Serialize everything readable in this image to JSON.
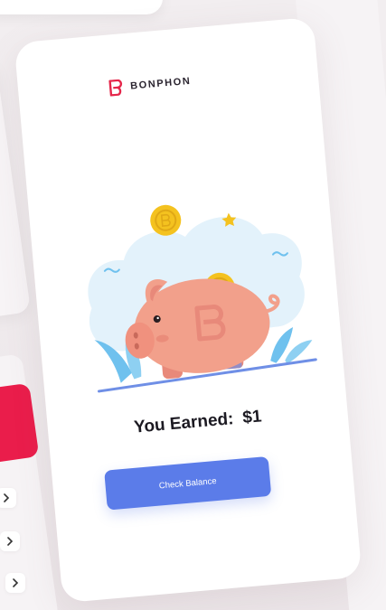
{
  "app": {
    "brand_name": "BONPHON",
    "logo_icon": "bonphon-logo-icon"
  },
  "main": {
    "earned_label": "You Earned:",
    "earned_amount": "$1",
    "check_balance_label": "Check Balance"
  },
  "illustration": {
    "icon": "piggy-bank-icon",
    "coin_icon": "coin-icon"
  },
  "colors": {
    "brand_red": "#e5264a",
    "button_blue": "#5b7ce9",
    "pig_pink": "#f2a08b",
    "coin_gold": "#f4c21f",
    "cloud_blue": "#e3f2fb",
    "leaf_blue": "#6fc1ee",
    "side_card_red": "#ea1d4b"
  },
  "side_panel": {
    "chevron_icon": "chevron-right-icon"
  }
}
